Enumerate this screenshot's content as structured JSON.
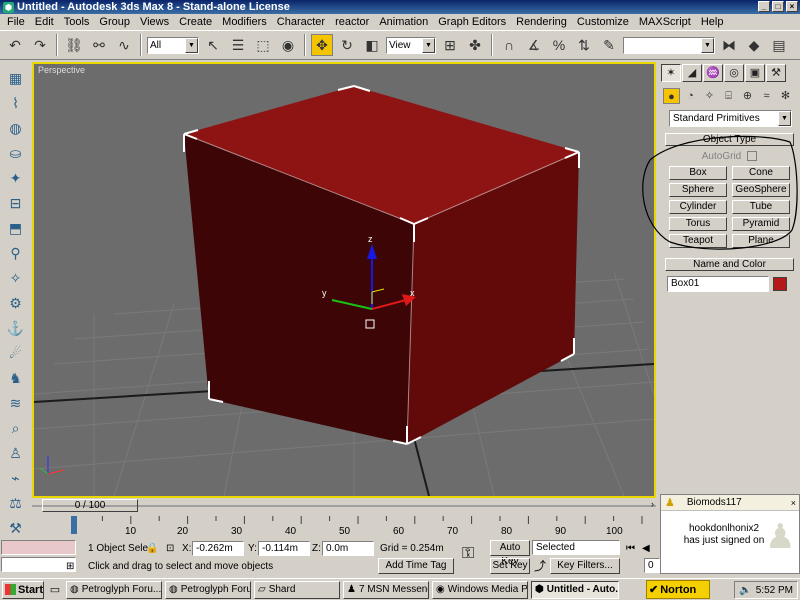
{
  "window": {
    "title": "Untitled - Autodesk 3ds Max 8 - Stand-alone License",
    "app_icon": "3ds-max-icon",
    "controls": [
      "_",
      "□",
      "×"
    ]
  },
  "menu": [
    "File",
    "Edit",
    "Tools",
    "Group",
    "Views",
    "Create",
    "Modifiers",
    "Character",
    "reactor",
    "Animation",
    "Graph Editors",
    "Rendering",
    "Customize",
    "MAXScript",
    "Help"
  ],
  "toolbar": {
    "selection_filter": "All",
    "reference_coord": "View"
  },
  "viewport": {
    "label": "Perspective",
    "axis_labels": {
      "x": "x",
      "y": "y",
      "z": "z"
    }
  },
  "command_panel": {
    "category": "Standard Primitives",
    "object_type_header": "Object Type",
    "autogrid_label": "AutoGrid",
    "object_buttons": [
      "Box",
      "Cone",
      "Sphere",
      "GeoSphere",
      "Cylinder",
      "Tube",
      "Torus",
      "Pyramid",
      "Teapot",
      "Plane"
    ],
    "name_color_header": "Name and Color",
    "object_name": "Box01",
    "object_color": "#b41818"
  },
  "notification": {
    "user": "Biomods117",
    "line1": "hookdonlhonix2",
    "line2": "has just signed on",
    "close": "×"
  },
  "timeline": {
    "frame_display": "0 / 100",
    "ruler_labels": [
      "10",
      "20",
      "30",
      "40",
      "50",
      "60",
      "70",
      "80",
      "90",
      "100"
    ]
  },
  "status": {
    "selection": "1 Object Sele",
    "x_label": "X:",
    "x_value": "-0.262m",
    "y_label": "Y:",
    "y_value": "-0.114m",
    "z_label": "Z:",
    "z_value": "0.0m",
    "grid": "Grid = 0.254m",
    "prompt": "Click and drag to select and move objects",
    "add_time_tag": "Add Time Tag",
    "auto_key": "Auto Key",
    "set_key": "Set Key",
    "key_mode": "Selected",
    "key_filters": "Key Filters...",
    "current_frame": "0"
  },
  "taskbar": {
    "start": "Start",
    "tasks": [
      "Petroglyph Foru...",
      "Petroglyph Foru...",
      "Shard",
      "7 MSN Messenger",
      "Windows Media P...",
      "Untitled - Auto..."
    ],
    "norton": "Norton",
    "clock": "5:52 PM"
  },
  "colors": {
    "viewport_bg": "#6c6c6c",
    "box_red": "#8b1414",
    "active_border": "#e8d800",
    "titlebar": "#0a246a"
  }
}
